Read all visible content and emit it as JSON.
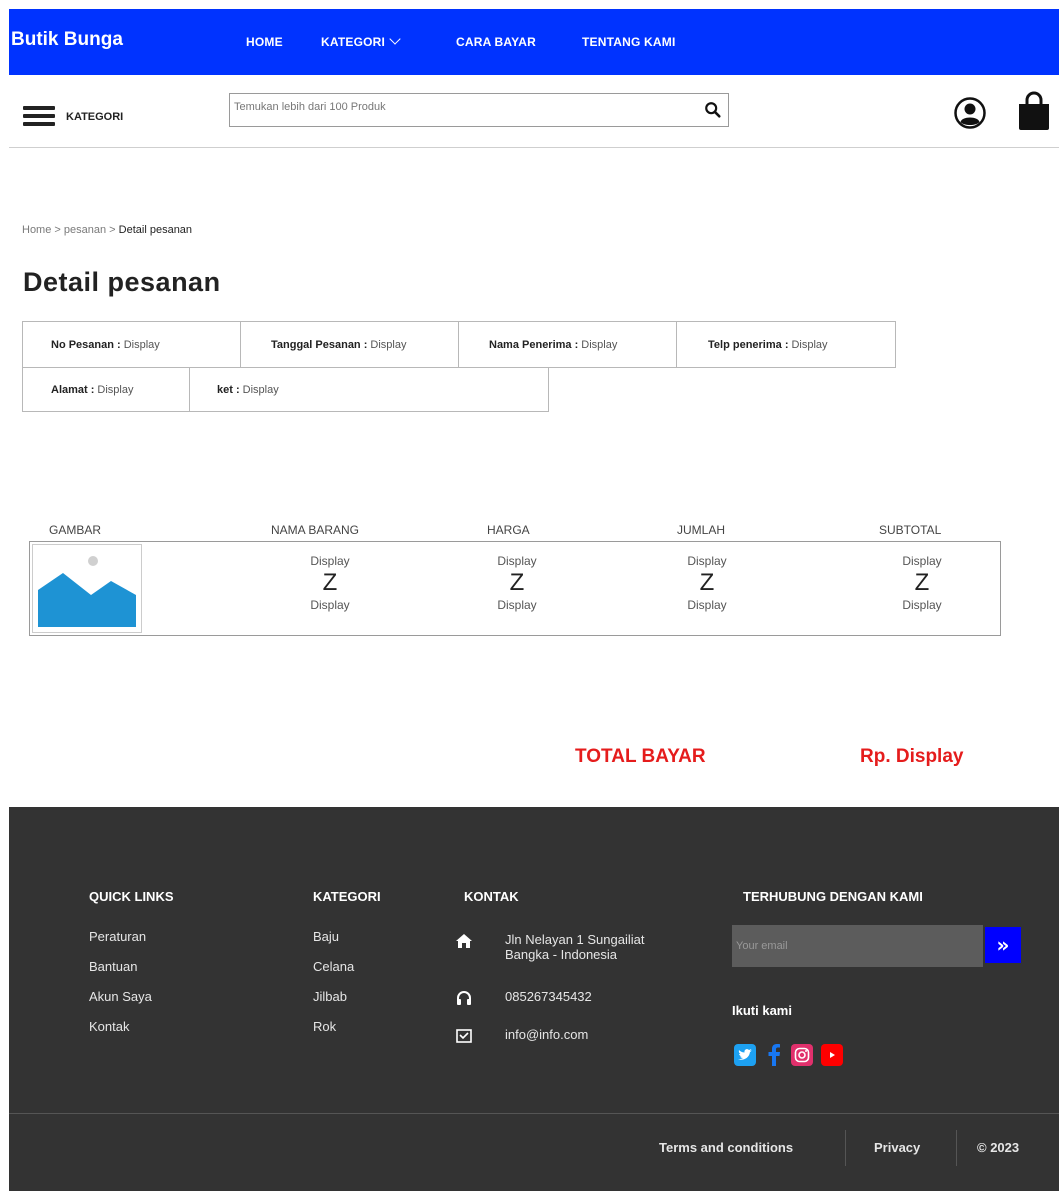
{
  "brand": "Butik Bunga",
  "nav": {
    "home": "HOME",
    "kategori": "KATEGORI",
    "cara_bayar": "CARA BAYAR",
    "tentang": "TENTANG KAMI"
  },
  "toolbar": {
    "kategori_label": "KATEGORI",
    "search_placeholder": "Temukan lebih dari 100 Produk"
  },
  "breadcrumb": {
    "home": "Home",
    "sep1": " > ",
    "pesanan": "pesanan",
    "sep2": " > ",
    "current": "Detail pesanan"
  },
  "page_title": "Detail  pesanan",
  "order_info": {
    "no_pesanan": {
      "label": "No Pesanan :",
      "value": "Display"
    },
    "tanggal": {
      "label": "Tanggal Pesanan :",
      "value": "Display"
    },
    "nama_penerima": {
      "label": "Nama Penerima :",
      "value": "Display"
    },
    "telp": {
      "label": "Telp penerima :",
      "value": "Display"
    },
    "alamat": {
      "label": "Alamat :",
      "value": "Display"
    },
    "ket": {
      "label": "ket :",
      "value": "Display"
    }
  },
  "product_table": {
    "headers": [
      "GAMBAR",
      "NAMA BARANG",
      "HARGA",
      "JUMLAH",
      "SUBTOTAL"
    ],
    "row": {
      "nama": {
        "top": "Display",
        "mid": "Z",
        "bottom": "Display"
      },
      "harga": {
        "top": "Display",
        "mid": "Z",
        "bottom": "Display"
      },
      "jumlah": {
        "top": "Display",
        "mid": "Z",
        "bottom": "Display"
      },
      "subtotal": {
        "top": "Display",
        "mid": "Z",
        "bottom": "Display"
      }
    }
  },
  "total": {
    "label": "TOTAL BAYAR",
    "value": "Rp. Display"
  },
  "footer": {
    "quick_links": {
      "title": "QUICK LINKS",
      "items": [
        "Peraturan",
        "Bantuan",
        "Akun Saya",
        "Kontak"
      ]
    },
    "kategori": {
      "title": "KATEGORI",
      "items": [
        "Baju",
        "Celana",
        "Jilbab",
        "Rok"
      ]
    },
    "kontak": {
      "title": "KONTAK",
      "address_line1": "Jln Nelayan 1 Sungailiat",
      "address_line2": "Bangka - Indonesia",
      "phone": "085267345432",
      "email": "info@info.com"
    },
    "connect": {
      "title": "TERHUBUNG DENGAN KAMI",
      "email_placeholder": "Your email",
      "submit": "»",
      "follow": "Ikuti kami"
    },
    "terms": "Terms and conditions",
    "privacy": "Privacy",
    "copyright": "© 2023"
  },
  "colors": {
    "nav_bg": "#0033ff",
    "footer_bg": "#333333",
    "total_red": "#e51c1c",
    "twitter": "#1da1f2",
    "facebook": "#1877f2",
    "instagram": "#e1306c",
    "youtube": "#ff0000"
  }
}
